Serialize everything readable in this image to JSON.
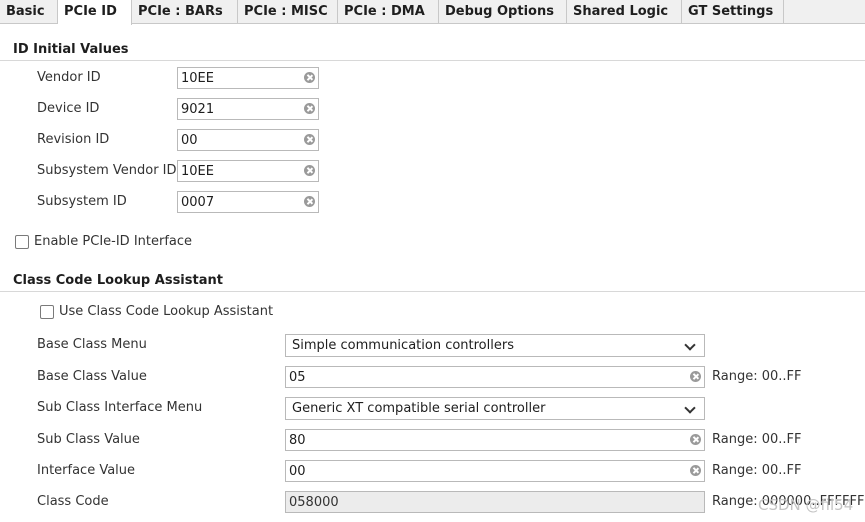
{
  "tabs": [
    {
      "label": "Basic",
      "active": false
    },
    {
      "label": "PCIe ID",
      "active": true
    },
    {
      "label": "PCIe : BARs",
      "active": false
    },
    {
      "label": "PCIe : MISC",
      "active": false
    },
    {
      "label": "PCIe : DMA",
      "active": false
    },
    {
      "label": "Debug Options",
      "active": false
    },
    {
      "label": "Shared Logic",
      "active": false
    },
    {
      "label": "GT Settings",
      "active": false
    }
  ],
  "id_initial": {
    "title": "ID Initial Values",
    "fields": [
      {
        "label": "Vendor ID",
        "value": "10EE"
      },
      {
        "label": "Device ID",
        "value": "9021"
      },
      {
        "label": "Revision ID",
        "value": "00"
      },
      {
        "label": "Subsystem Vendor ID",
        "value": "10EE"
      },
      {
        "label": "Subsystem ID",
        "value": "0007"
      }
    ],
    "enable_pcie_id": {
      "label": "Enable PCIe-ID Interface",
      "checked": false
    }
  },
  "class_code": {
    "title": "Class Code Lookup Assistant",
    "use_assistant": {
      "label": "Use Class Code Lookup Assistant",
      "checked": false
    },
    "base_class_menu": {
      "label": "Base Class Menu",
      "value": "Simple communication controllers"
    },
    "base_class_value": {
      "label": "Base Class Value",
      "value": "05",
      "range": "Range: 00..FF"
    },
    "sub_class_menu": {
      "label": "Sub Class Interface Menu",
      "value": "Generic XT compatible serial controller"
    },
    "sub_class_value": {
      "label": "Sub Class Value",
      "value": "80",
      "range": "Range: 00..FF"
    },
    "interface_value": {
      "label": "Interface Value",
      "value": "00",
      "range": "Range: 00..FF"
    },
    "class_code_value": {
      "label": "Class Code",
      "value": "058000",
      "range": "Range: 000000..FFFFFF"
    }
  },
  "watermark": "CSDN @fil54"
}
